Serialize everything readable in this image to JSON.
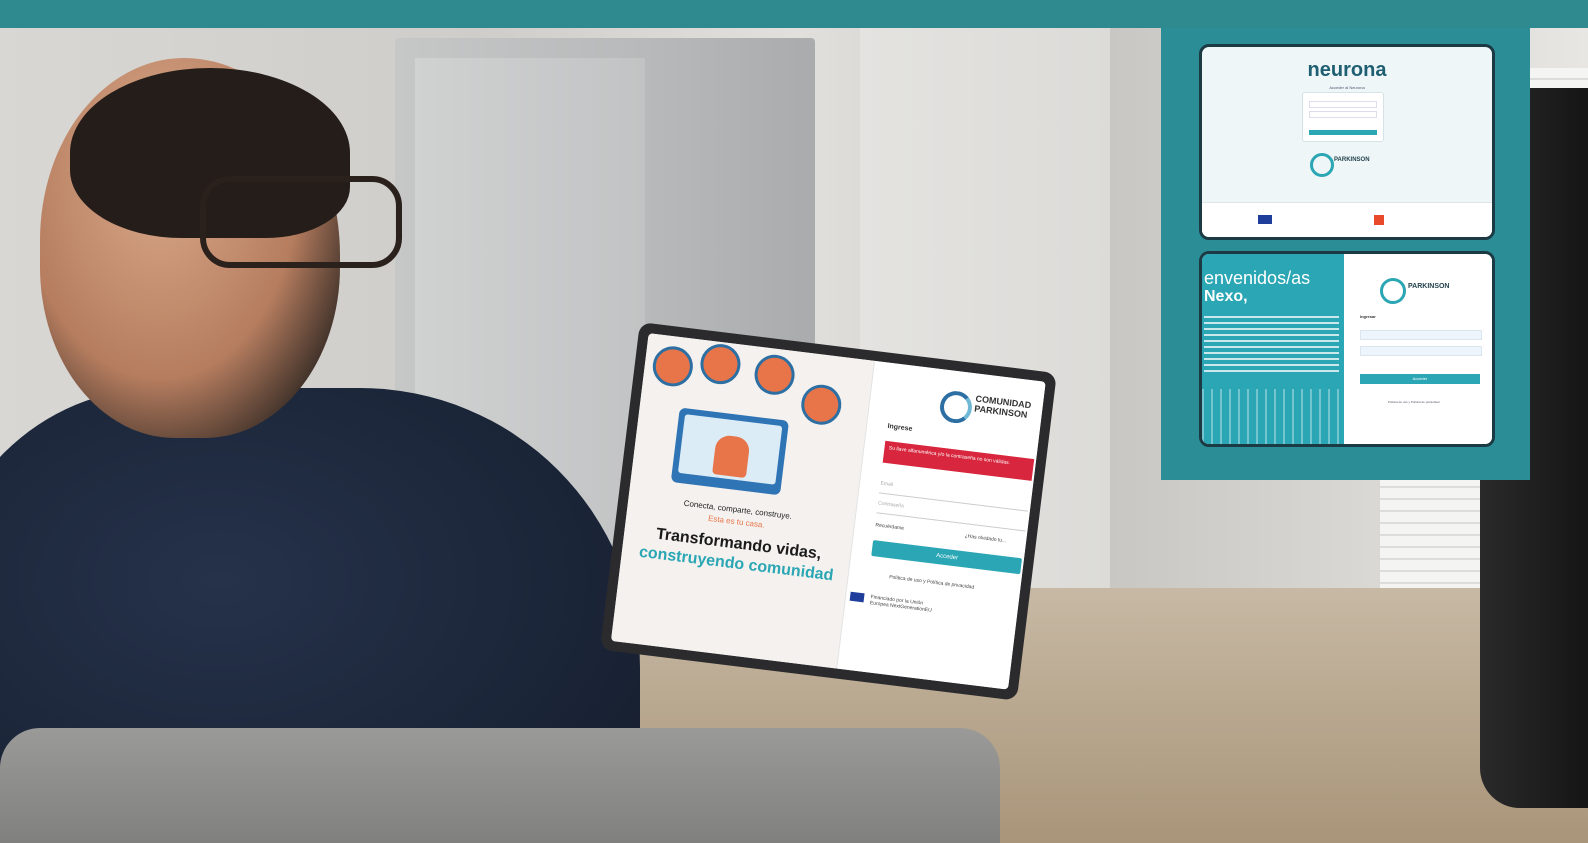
{
  "laptop_screen": {
    "tagline": "Conecta, comparte, construye.",
    "tagline_accent": "Esta es tu casa.",
    "headline": "Transformando vidas,",
    "headline_accent": "construyendo comunidad",
    "logo_line1": "COMUNIDAD",
    "logo_line2": "PARKINSON",
    "form_title": "Ingrese",
    "error_message": "Su llave alfanumérica y/o la contraseña no son válidas.",
    "field_email": "Email",
    "field_password": "Contraseña",
    "remember": "Recuérdame",
    "forgot": "¿Has olvidado tu...",
    "login_button": "Acceder",
    "privacy": "Política de uso y Política de privacidad",
    "funding": "Financiado por la Unión Europea NextGenerationEU"
  },
  "inset_top": {
    "brand": "neurona",
    "subtitle": "Acceder al Neurona",
    "partner": "PARKINSON"
  },
  "inset_bottom": {
    "welcome": "envenidos/as",
    "nexo": "Nexo,",
    "partner": "PARKINSON",
    "form_title": "Ingresar",
    "login_button": "Acceder",
    "privacy": "Política de uso y Política de privacidad"
  },
  "colors": {
    "teal": "#2aa6b4",
    "panel": "#2b8e97",
    "error": "#d7263d",
    "accent_orange": "#e8744a"
  }
}
